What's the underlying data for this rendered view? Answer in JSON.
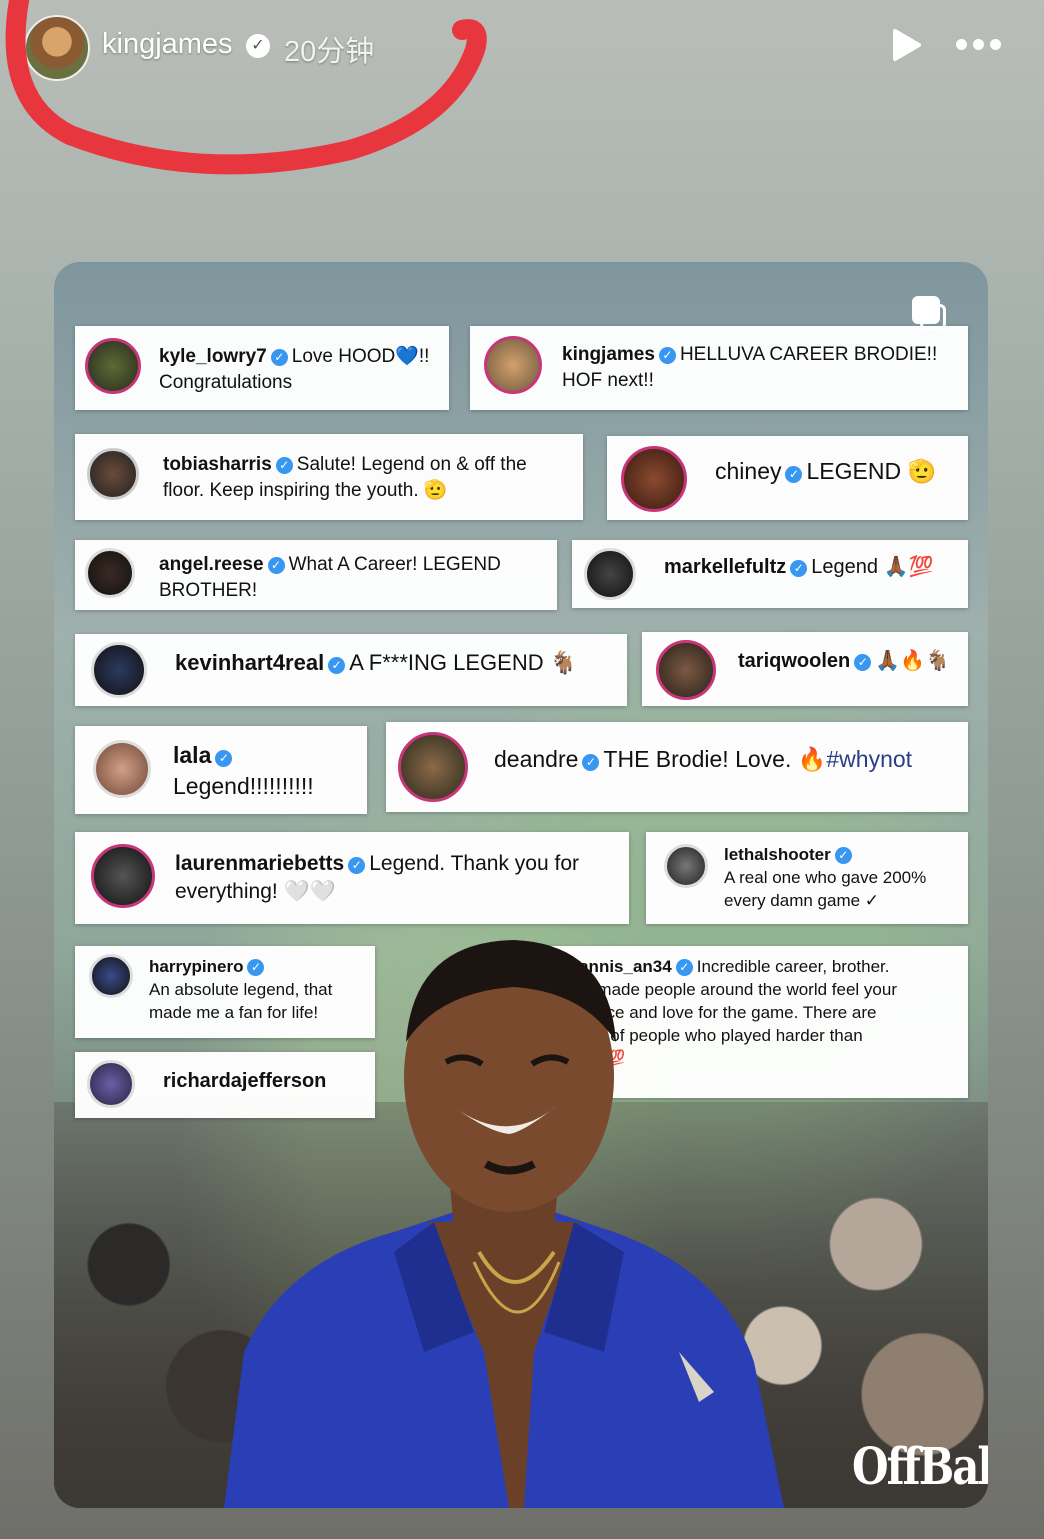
{
  "header": {
    "username": "kingjames",
    "timestamp": "20分钟",
    "icons": [
      "avatar",
      "verified-icon",
      "play-icon",
      "more-icon"
    ]
  },
  "comments": [
    {
      "user": "kyle_lowry7",
      "text": "Love HOOD💙!!",
      "text2": "Congratulations"
    },
    {
      "user": "kingjames",
      "text": "HELLUVA CAREER BRODIE!!",
      "text2": "HOF next!!"
    },
    {
      "user": "tobiasharris",
      "text": "Salute! Legend on & off the",
      "text2": "floor. Keep inspiring the youth. 🫡"
    },
    {
      "user": "chiney",
      "text": "LEGEND 🫡"
    },
    {
      "user": "angel.reese",
      "text": "What A Career! LEGEND",
      "text2": "BROTHER!"
    },
    {
      "user": "markellefultz",
      "text": "Legend 🙏🏾💯"
    },
    {
      "user": "kevinhart4real",
      "text": "A  F***ING LEGEND 🐐"
    },
    {
      "user": "tariqwoolen",
      "text": "🙏🏾🔥🐐"
    },
    {
      "user": "lala",
      "text2": "Legend!!!!!!!!!!"
    },
    {
      "user": "deandre",
      "text": "THE Brodie! Love. 🔥",
      "hashtag": "#whynot"
    },
    {
      "user": "laurenmariebetts",
      "text": "Legend. Thank you for",
      "text2": "everything! 🤍🤍"
    },
    {
      "user": "lethalshooter",
      "text2": "A real one who gave 200%",
      "text3": "every damn game ✓"
    },
    {
      "user": "harrypinero",
      "text2": "An absolute legend, that",
      "text3": "made me a fan for life!"
    },
    {
      "user": "giannis_an34",
      "text": "Incredible career, brother.",
      "text2": "You made people around the world feel your",
      "text3": "resence and love for the game. There are",
      "text4": "t a lot of people who played harder than",
      "text5": "u. 🫡💯"
    },
    {
      "user": "richardajefferson"
    }
  ],
  "logo": "OffBall",
  "colors": {
    "accent_red": "#e8363f",
    "verified_blue": "#3897f0"
  }
}
